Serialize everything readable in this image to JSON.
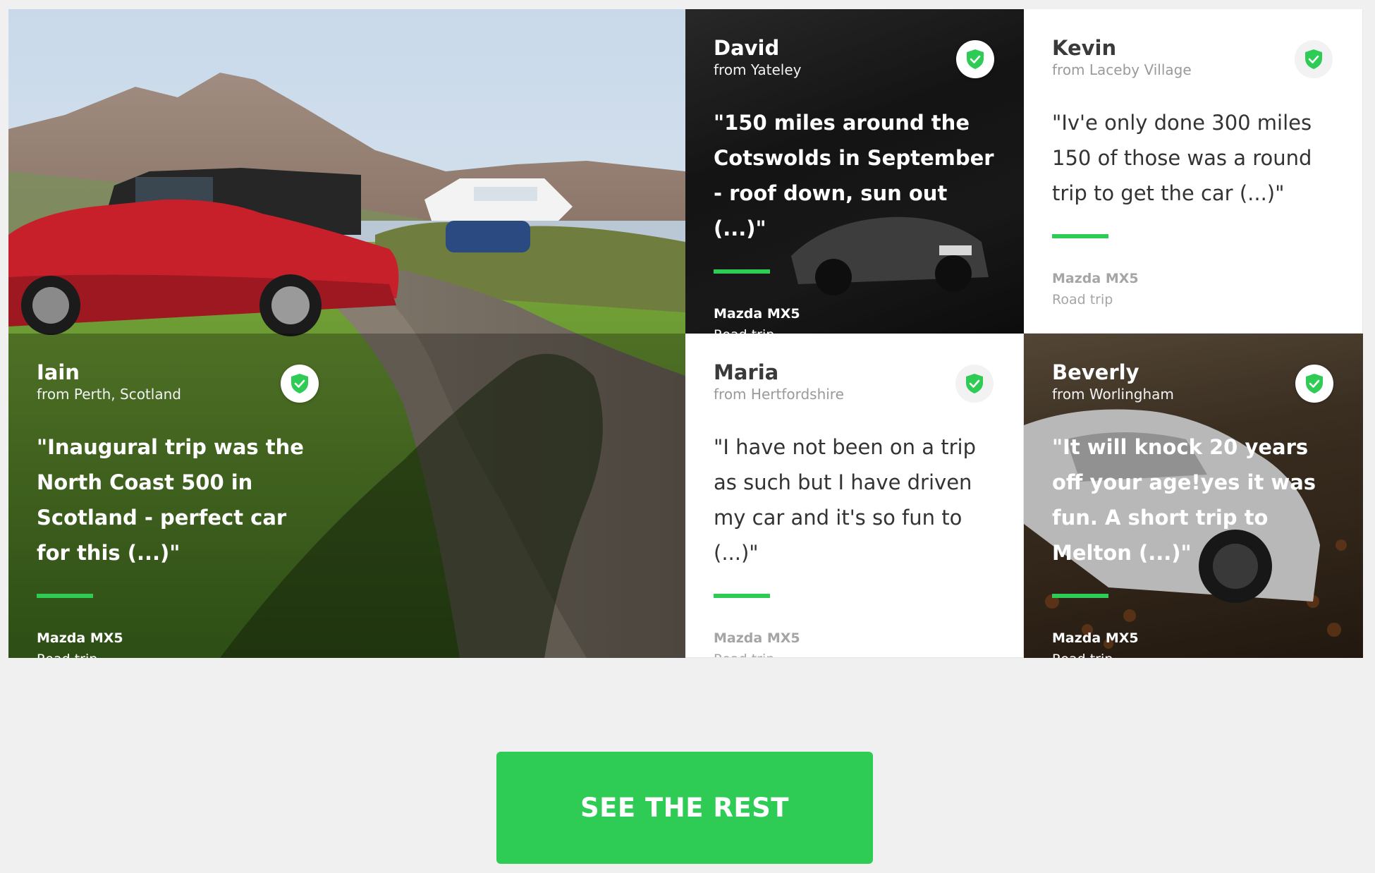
{
  "colors": {
    "accent": "#2ecc55",
    "page_background": "#f0f0f0"
  },
  "testimonials": [
    {
      "name": "David",
      "from": "from Yateley",
      "quote": "\"150 miles around the Cotswolds in September - roof down, sun out (...)\"",
      "model": "Mazda MX5",
      "trip": "Road trip",
      "badge_icon": "shield-check-icon"
    },
    {
      "name": "Kevin",
      "from": "from Laceby Village",
      "quote": "\"Iv'e only done 300 miles 150 of those was a round trip to get the car (...)\"",
      "model": "Mazda MX5",
      "trip": "Road trip",
      "badge_icon": "shield-check-icon"
    },
    {
      "name": "Iain",
      "from": "from Perth, Scotland",
      "quote": "\"Inaugural trip was the North Coast 500 in Scotland - perfect car for this (...)\"",
      "model": "Mazda MX5",
      "trip": "Road trip",
      "badge_icon": "shield-check-icon"
    },
    {
      "name": "Maria",
      "from": "from Hertfordshire",
      "quote": "\"I have not been on a trip as such but I have driven my car and it's so fun to (...)\"",
      "model": "Mazda MX5",
      "trip": "Road trip",
      "badge_icon": "shield-check-icon"
    },
    {
      "name": "Beverly",
      "from": "from Worlingham",
      "quote": "\"It will knock 20 years off your age!yes it was fun. A short trip to Melton (...)\"",
      "model": "Mazda MX5",
      "trip": "Road trip",
      "badge_icon": "shield-check-icon"
    }
  ],
  "cta": {
    "label": "SEE THE REST"
  }
}
